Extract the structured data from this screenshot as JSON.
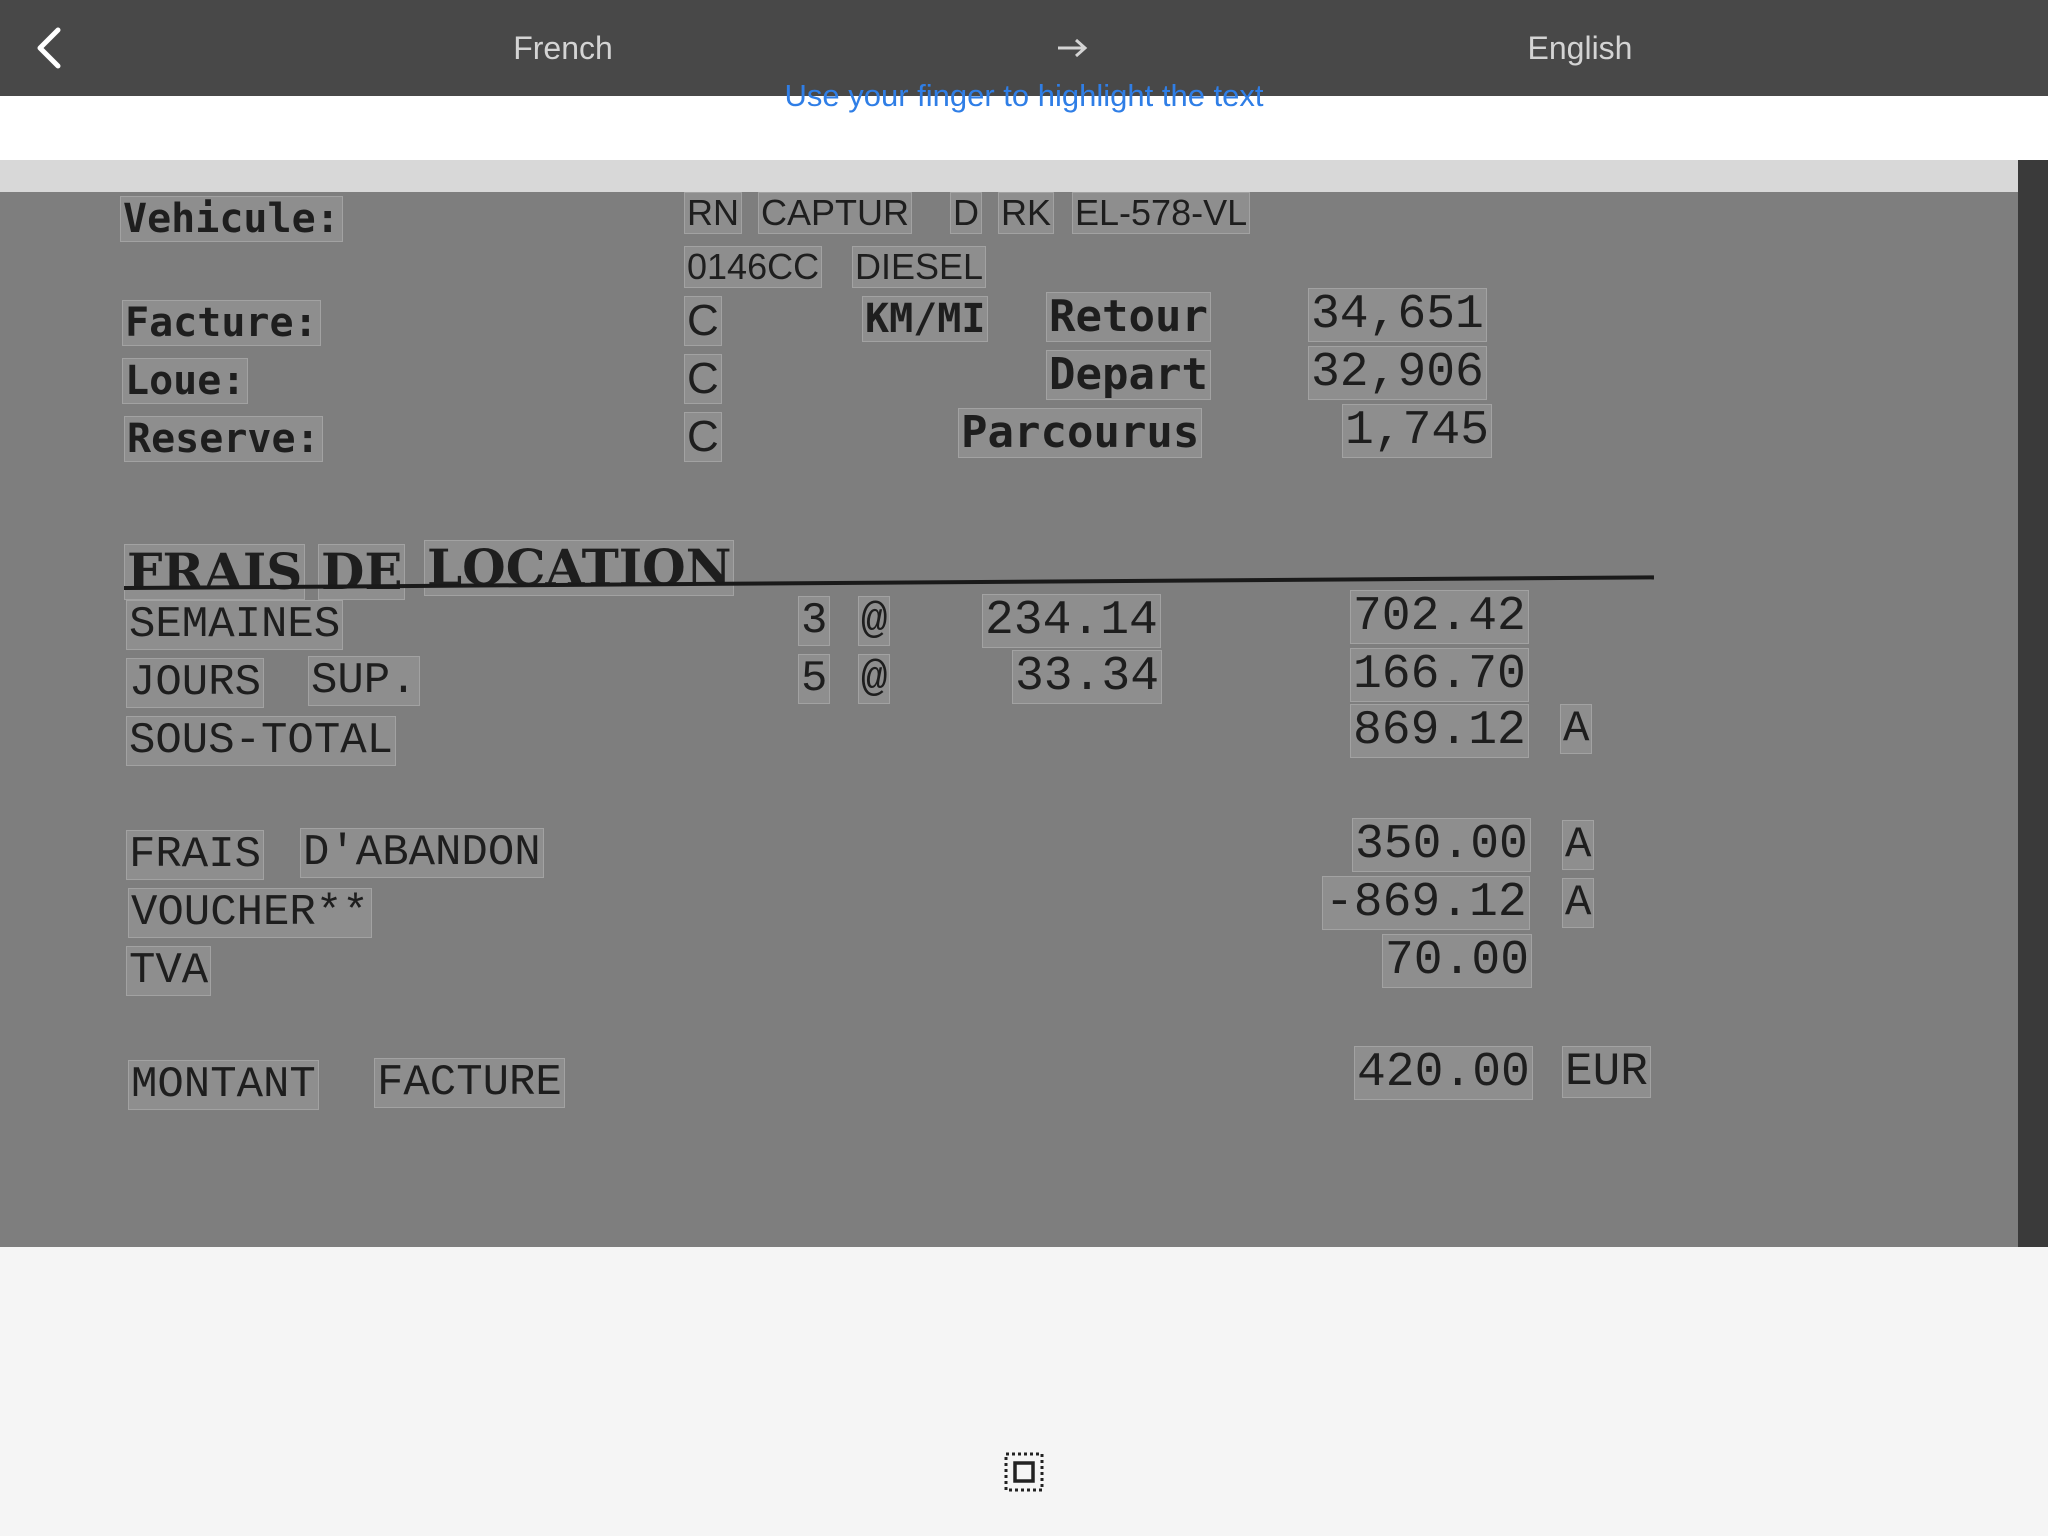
{
  "header": {
    "source_language": "French",
    "target_language": "English",
    "back_icon": "chevron-left-icon",
    "swap_icon": "arrow-right-icon"
  },
  "hint": "Use your finger to highlight the text",
  "document": {
    "vehicle": {
      "label": "Vehicule:",
      "values": [
        "RN",
        "CAPTUR",
        "D",
        "RK",
        "EL-578-VL",
        "0146CC",
        "DIESEL"
      ]
    },
    "fields": [
      {
        "label": "Facture:",
        "code": "C"
      },
      {
        "label": "Loue:",
        "code": "C"
      },
      {
        "label": "Reserve:",
        "code": "C"
      }
    ],
    "mileage": {
      "header": "KM/MI",
      "rows": [
        {
          "label": "Retour",
          "value": "34,651"
        },
        {
          "label": "Depart",
          "value": "32,906"
        },
        {
          "label": "Parcourus",
          "value": "1,745"
        }
      ]
    },
    "section_title": [
      "FRAIS",
      "DE",
      "LOCATION"
    ],
    "charges": [
      {
        "label": [
          "SEMAINES"
        ],
        "qty": "3",
        "at": "@",
        "rate": "234.14",
        "amount": "702.42",
        "flag": ""
      },
      {
        "label": [
          "JOURS",
          "SUP."
        ],
        "qty": "5",
        "at": "@",
        "rate": "33.34",
        "amount": "166.70",
        "flag": ""
      },
      {
        "label": [
          "SOUS-TOTAL"
        ],
        "qty": "",
        "at": "",
        "rate": "",
        "amount": "869.12",
        "flag": "A"
      },
      {
        "label": [
          "FRAIS",
          "D'ABANDON"
        ],
        "qty": "",
        "at": "",
        "rate": "",
        "amount": "350.00",
        "flag": "A"
      },
      {
        "label": [
          "VOUCHER**"
        ],
        "qty": "",
        "at": "",
        "rate": "",
        "amount": "-869.12",
        "flag": "A"
      },
      {
        "label": [
          "TVA"
        ],
        "qty": "",
        "at": "",
        "rate": "",
        "amount": "70.00",
        "flag": ""
      }
    ],
    "total": {
      "label": [
        "MONTANT",
        "FACTURE"
      ],
      "amount": "420.00",
      "currency": "EUR"
    }
  },
  "footer": {
    "select_icon": "select-all-icon"
  },
  "colors": {
    "topbar": "#484848",
    "accent": "#2f7ee6",
    "document_bg": "#7e7e7e"
  }
}
